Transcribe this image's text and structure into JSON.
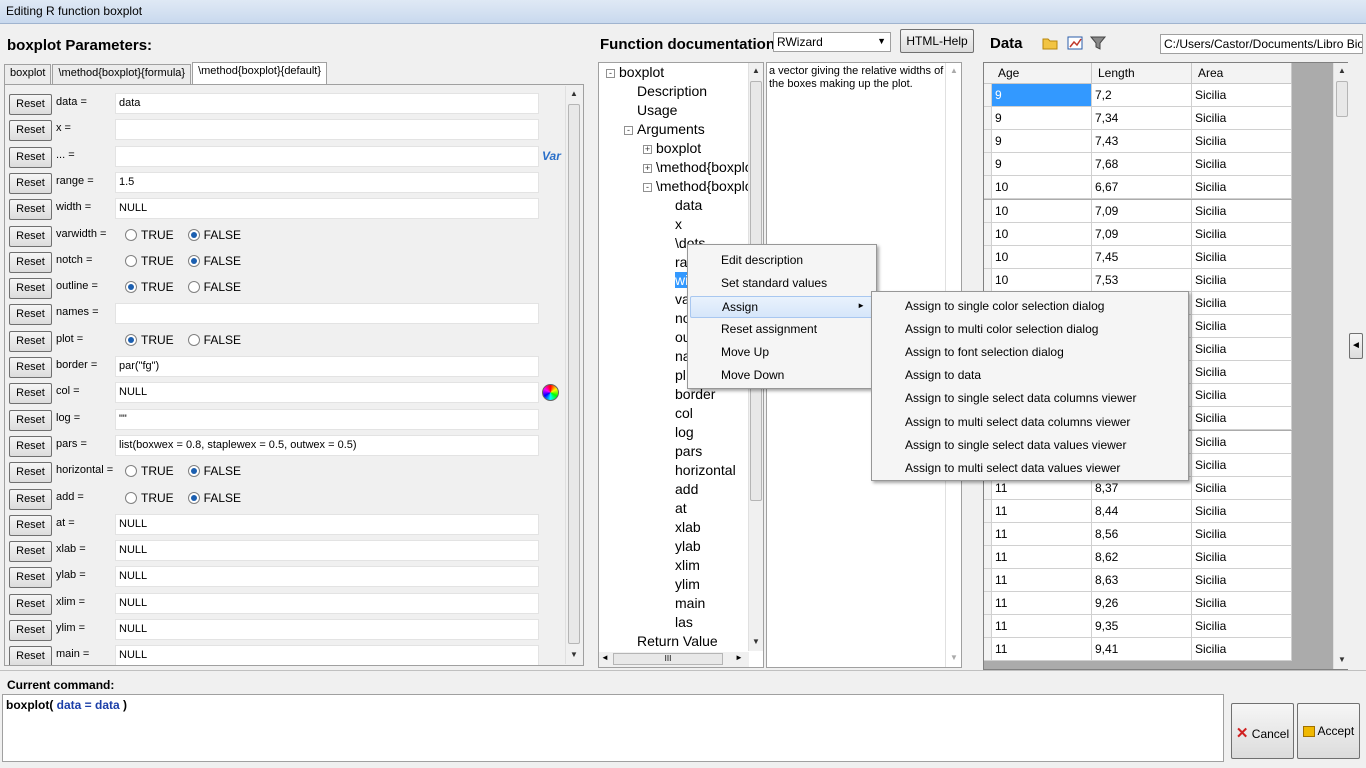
{
  "window": {
    "title": "Editing R function boxplot"
  },
  "params": {
    "header": "boxplot Parameters:",
    "tabs": [
      "boxplot",
      "\\method{boxplot}{formula}",
      "\\method{boxplot}{default}"
    ],
    "reset_label": "Reset",
    "true_label": "TRUE",
    "false_label": "FALSE",
    "var_label": "Var",
    "rows": [
      {
        "label": "data =",
        "value": "data"
      },
      {
        "label": "x =",
        "value": ""
      },
      {
        "label": "... =",
        "value": ""
      },
      {
        "label": "range =",
        "value": "1.5"
      },
      {
        "label": "width =",
        "value": "NULL"
      },
      {
        "label": "varwidth =",
        "radio": "FALSE"
      },
      {
        "label": "notch =",
        "radio": "FALSE"
      },
      {
        "label": "outline =",
        "radio": "TRUE"
      },
      {
        "label": "names =",
        "value": ""
      },
      {
        "label": "plot =",
        "radio": "TRUE"
      },
      {
        "label": "border =",
        "value": "par(\"fg\")"
      },
      {
        "label": "col =",
        "value": "NULL"
      },
      {
        "label": "log =",
        "value": "\"\""
      },
      {
        "label": "pars =",
        "value": "list(boxwex = 0.8, staplewex = 0.5, outwex = 0.5)"
      },
      {
        "label": "horizontal =",
        "radio": "FALSE"
      },
      {
        "label": "add =",
        "radio": "FALSE"
      },
      {
        "label": "at =",
        "value": "NULL"
      },
      {
        "label": "xlab =",
        "value": "NULL"
      },
      {
        "label": "ylab =",
        "value": "NULL"
      },
      {
        "label": "xlim =",
        "value": "NULL"
      },
      {
        "label": "ylim =",
        "value": "NULL"
      },
      {
        "label": "main =",
        "value": "NULL"
      }
    ]
  },
  "doc": {
    "header": "Function documentation",
    "combo_value": "RWizard",
    "help_button": "HTML-Help",
    "description": "a vector giving the relative widths of the boxes making      up the plot.",
    "tree": [
      {
        "text": "boxplot",
        "level": 0,
        "exp": "-"
      },
      {
        "text": "Description",
        "level": 1
      },
      {
        "text": "Usage",
        "level": 1
      },
      {
        "text": "Arguments",
        "level": 1,
        "exp": "-"
      },
      {
        "text": "boxplot",
        "level": 2,
        "exp": "+"
      },
      {
        "text": "\\method{boxplo",
        "level": 2,
        "exp": "+"
      },
      {
        "text": "\\method{boxplo",
        "level": 2,
        "exp": "-"
      },
      {
        "text": "data",
        "level": 3
      },
      {
        "text": "x",
        "level": 3
      },
      {
        "text": "\\dots",
        "level": 3
      },
      {
        "text": "ra",
        "level": 3
      },
      {
        "text": "wi",
        "level": 3,
        "selected": true
      },
      {
        "text": "va",
        "level": 3
      },
      {
        "text": "no",
        "level": 3
      },
      {
        "text": "ou",
        "level": 3
      },
      {
        "text": "na",
        "level": 3
      },
      {
        "text": "pl",
        "level": 3
      },
      {
        "text": "border",
        "level": 3
      },
      {
        "text": "col",
        "level": 3
      },
      {
        "text": "log",
        "level": 3
      },
      {
        "text": "pars",
        "level": 3
      },
      {
        "text": "horizontal",
        "level": 3
      },
      {
        "text": "add",
        "level": 3
      },
      {
        "text": "at",
        "level": 3
      },
      {
        "text": "xlab",
        "level": 3
      },
      {
        "text": "ylab",
        "level": 3
      },
      {
        "text": "xlim",
        "level": 3
      },
      {
        "text": "ylim",
        "level": 3
      },
      {
        "text": "main",
        "level": 3
      },
      {
        "text": "las",
        "level": 3
      },
      {
        "text": "Return Value",
        "level": 1
      }
    ],
    "hscroll_grip": "III"
  },
  "data_panel": {
    "header": "Data",
    "path": "C:/Users/Castor/Documents/Libro Bioestadística",
    "columns": [
      "Age",
      "Length",
      "Area"
    ],
    "rows": [
      [
        "9",
        "7,2",
        "Sicilia"
      ],
      [
        "9",
        "7,34",
        "Sicilia"
      ],
      [
        "9",
        "7,43",
        "Sicilia"
      ],
      [
        "9",
        "7,68",
        "Sicilia"
      ],
      [
        "10",
        "6,67",
        "Sicilia"
      ],
      [
        "10",
        "7,09",
        "Sicilia"
      ],
      [
        "10",
        "7,09",
        "Sicilia"
      ],
      [
        "10",
        "7,45",
        "Sicilia"
      ],
      [
        "10",
        "7,53",
        "Sicilia"
      ],
      [
        "",
        "",
        "Sicilia"
      ],
      [
        "",
        "",
        "Sicilia"
      ],
      [
        "",
        "",
        "Sicilia"
      ],
      [
        "",
        "",
        "Sicilia"
      ],
      [
        "",
        "",
        "Sicilia"
      ],
      [
        "",
        "",
        "Sicilia"
      ],
      [
        "",
        "",
        "Sicilia"
      ],
      [
        "",
        "",
        "Sicilia"
      ],
      [
        "11",
        "8,37",
        "Sicilia"
      ],
      [
        "11",
        "8,44",
        "Sicilia"
      ],
      [
        "11",
        "8,56",
        "Sicilia"
      ],
      [
        "11",
        "8,62",
        "Sicilia"
      ],
      [
        "11",
        "8,63",
        "Sicilia"
      ],
      [
        "11",
        "9,26",
        "Sicilia"
      ],
      [
        "11",
        "9,35",
        "Sicilia"
      ],
      [
        "11",
        "9,41",
        "Sicilia"
      ]
    ]
  },
  "context_menu": {
    "items": [
      "Edit description",
      "Set standard values",
      "Assign",
      "Reset assignment",
      "Move Up",
      "Move Down"
    ],
    "submenu": [
      "Assign to single color selection dialog",
      "Assign to multi color selection dialog",
      "Assign to font selection dialog",
      "Assign to data",
      "Assign to single select data columns viewer",
      "Assign to multi select data columns viewer",
      "Assign to single select data values viewer",
      "Assign to multi select data values viewer"
    ]
  },
  "command": {
    "header": "Current command:",
    "func": "boxplot(",
    "arg": " data = data ",
    "close": " )",
    "cancel": "Cancel",
    "accept": "Accept"
  },
  "colors": {
    "accent": "#1c5fb0",
    "selected_cell": "#3399ff",
    "cmd_arg": "#1a3ea8"
  }
}
